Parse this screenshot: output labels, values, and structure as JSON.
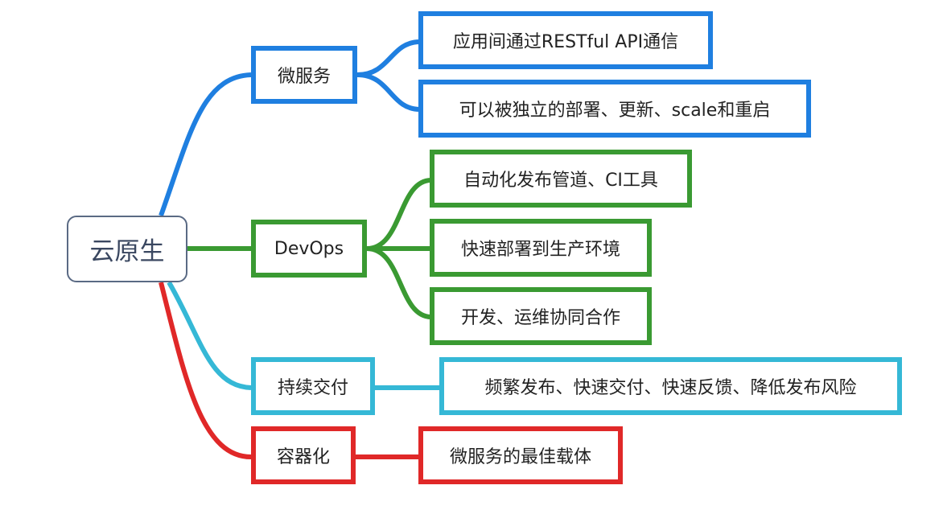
{
  "root": {
    "label": "云原生"
  },
  "colors": {
    "microservice": "#1f7fe0",
    "devops": "#3a9a32",
    "delivery": "#35b8d6",
    "container": "#e02828"
  },
  "branches": [
    {
      "label": "微服务",
      "children": [
        "应用间通过RESTful API通信",
        "可以被独立的部署、更新、scale和重启"
      ]
    },
    {
      "label": "DevOps",
      "children": [
        "自动化发布管道、CI工具",
        "快速部署到生产环境",
        "开发、运维协同合作"
      ]
    },
    {
      "label": "持续交付",
      "children": [
        "频繁发布、快速交付、快速反馈、降低发布风险"
      ]
    },
    {
      "label": "容器化",
      "children": [
        "微服务的最佳载体"
      ]
    }
  ]
}
